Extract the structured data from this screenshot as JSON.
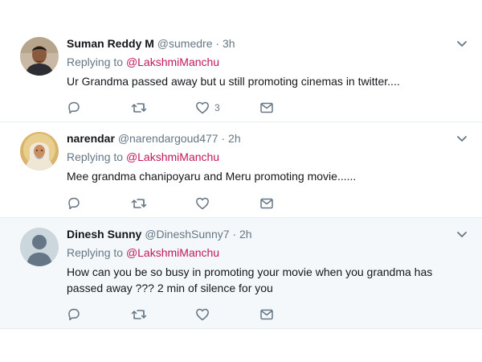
{
  "tweets": [
    {
      "name": "Suman Reddy M",
      "handle": "@sumedre",
      "dot": "·",
      "time": "3h",
      "replying_prefix": "Replying to",
      "replying_to": "@LakshmiManchu",
      "text": "Ur Grandma passed away but u still promoting cinemas in twitter....",
      "like_count": "3"
    },
    {
      "name": "narendar",
      "handle": "@narendargoud477",
      "dot": "·",
      "time": "2h",
      "replying_prefix": "Replying to",
      "replying_to": "@LakshmiManchu",
      "text": "Mee grandma chanipoyaru and Meru promoting movie......",
      "like_count": ""
    },
    {
      "name": "Dinesh Sunny",
      "handle": "@DineshSunny7",
      "dot": "·",
      "time": "2h",
      "replying_prefix": "Replying to",
      "replying_to": "@LakshmiManchu",
      "text": "How can you be so busy in promoting your movie when you grandma has passed away ??? 2 min of silence for you",
      "like_count": ""
    }
  ],
  "icons": {
    "reply": "reply-icon",
    "retweet": "retweet-icon",
    "like": "heart-icon",
    "dm": "envelope-icon",
    "caret": "chevron-down-icon"
  },
  "colors": {
    "mention": "#c2185b",
    "muted": "#657786",
    "icon": "#657786",
    "highlight_bg": "#f5f8fa"
  }
}
